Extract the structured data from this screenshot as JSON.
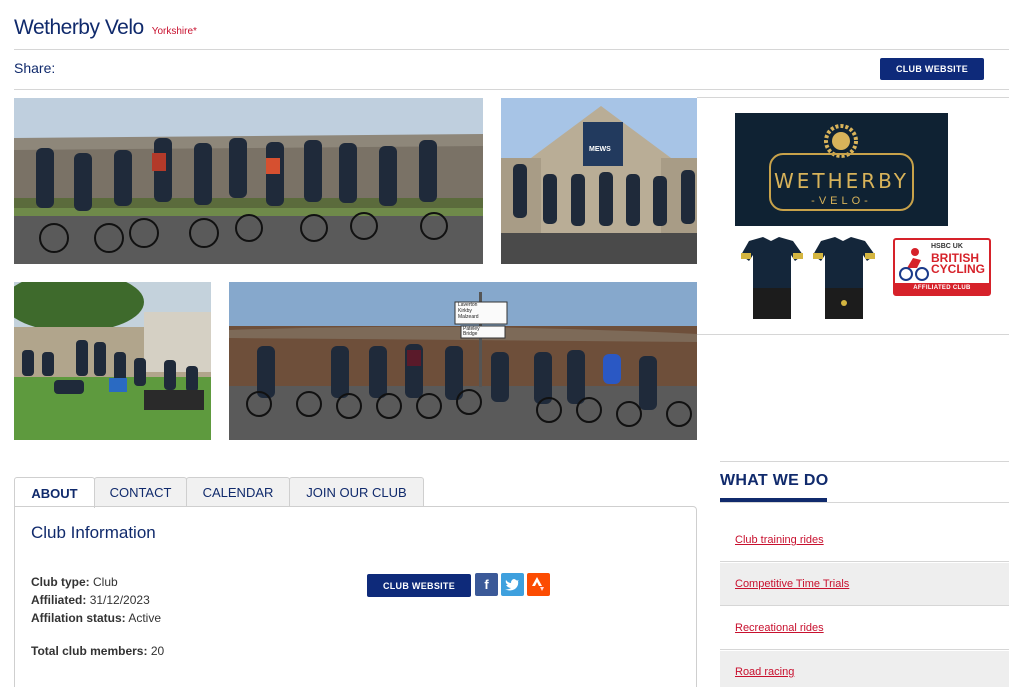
{
  "header": {
    "club_name": "Wetherby Velo",
    "region": "Yorkshire*"
  },
  "share": {
    "label": "Share:"
  },
  "buttons": {
    "club_website": "CLUB WEBSITE"
  },
  "sidebar_logo": {
    "word": "WETHERBY",
    "sub": "-VELO-"
  },
  "bc_badge": {
    "hsbc": "HSBC UK",
    "title": "BRITISH CYCLING",
    "affiliated": "AFFILIATED CLUB"
  },
  "photo_signs": {
    "line1": "Laverton",
    "line2": "Kirkby",
    "line3": "Malzeard",
    "line4": "Pateley",
    "line5": "Bridge",
    "cafe": "MEWS"
  },
  "tabs": [
    "ABOUT",
    "CONTACT",
    "CALENDAR",
    "JOIN OUR CLUB"
  ],
  "panel": {
    "title": "Club Information",
    "club_type_label": "Club type:",
    "club_type": "Club",
    "affiliated_label": "Affiliated:",
    "affiliated": "31/12/2023",
    "status_label": "Affilation status:",
    "status": "Active",
    "members_label": "Total club members:",
    "members": "20"
  },
  "social": {
    "facebook": "f",
    "twitter": "t",
    "strava": "^"
  },
  "what_we_do": {
    "title": "WHAT WE DO",
    "items": [
      "Club training rides",
      "Competitive Time Trials",
      "Recreational rides",
      "Road racing"
    ]
  },
  "colors": {
    "navy": "#102a6c",
    "button": "#0e2a7a",
    "red": "#c8102e",
    "logo_bg": "#0f2233",
    "gold": "#d8b35a"
  },
  "icons": [
    "facebook-icon",
    "twitter-icon",
    "strava-icon",
    "british-cycling-logo",
    "wetherby-velo-logo",
    "jersey-image"
  ]
}
